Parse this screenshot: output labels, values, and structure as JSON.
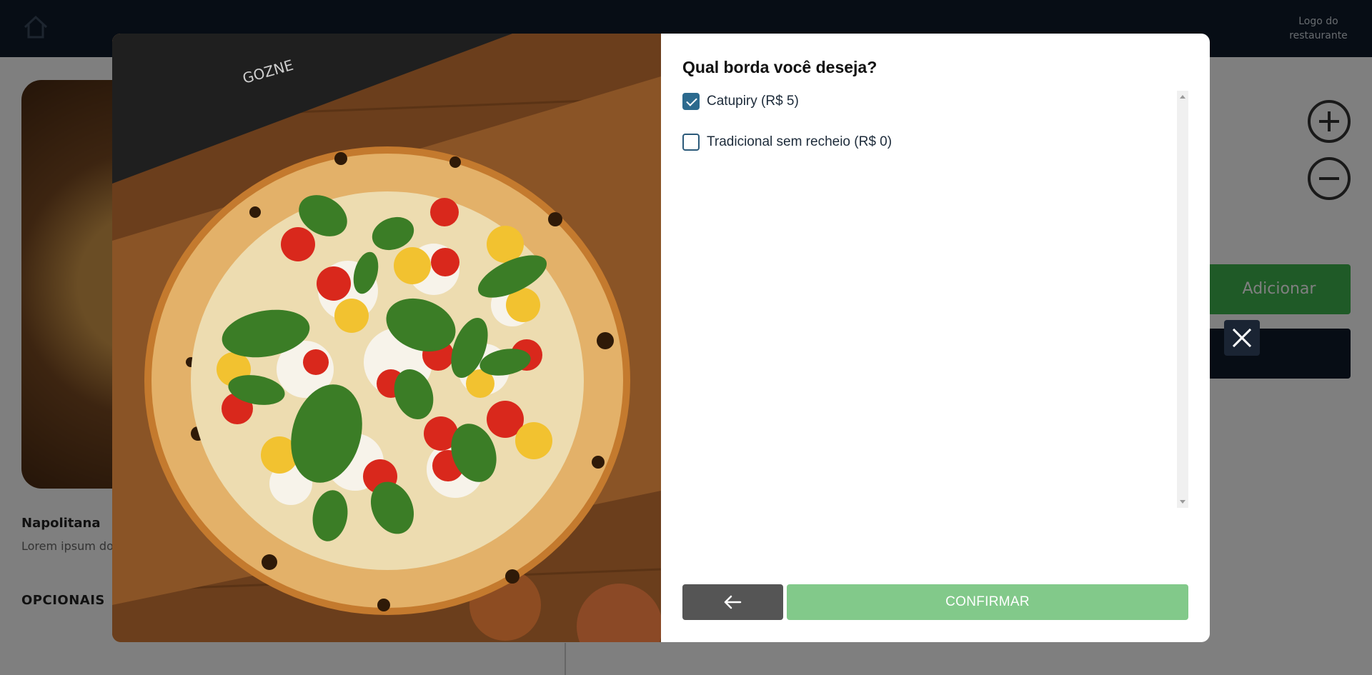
{
  "background": {
    "logo_text": "Logo do restaurante",
    "product_title": "Napolitana",
    "product_description": "Lorem ipsum dolor",
    "section_title": "OPCIONAIS",
    "add_label": "Adicionar"
  },
  "modal": {
    "title": "Qual borda você deseja?",
    "options": [
      {
        "label": "Catupiry (R$ 5)",
        "checked": true
      },
      {
        "label": "Tradicional sem recheio (R$ 0)",
        "checked": false
      }
    ],
    "confirm_label": "CONFIRMAR"
  },
  "colors": {
    "topbar": "#0e1b2b",
    "confirm": "#82c98a",
    "back": "#555555",
    "checkbox": "#2c6a8e"
  },
  "icons": {
    "back": "arrow-left-icon",
    "close": "close-icon",
    "home": "home-icon",
    "plus": "plus-circle-icon",
    "minus": "minus-circle-icon"
  }
}
